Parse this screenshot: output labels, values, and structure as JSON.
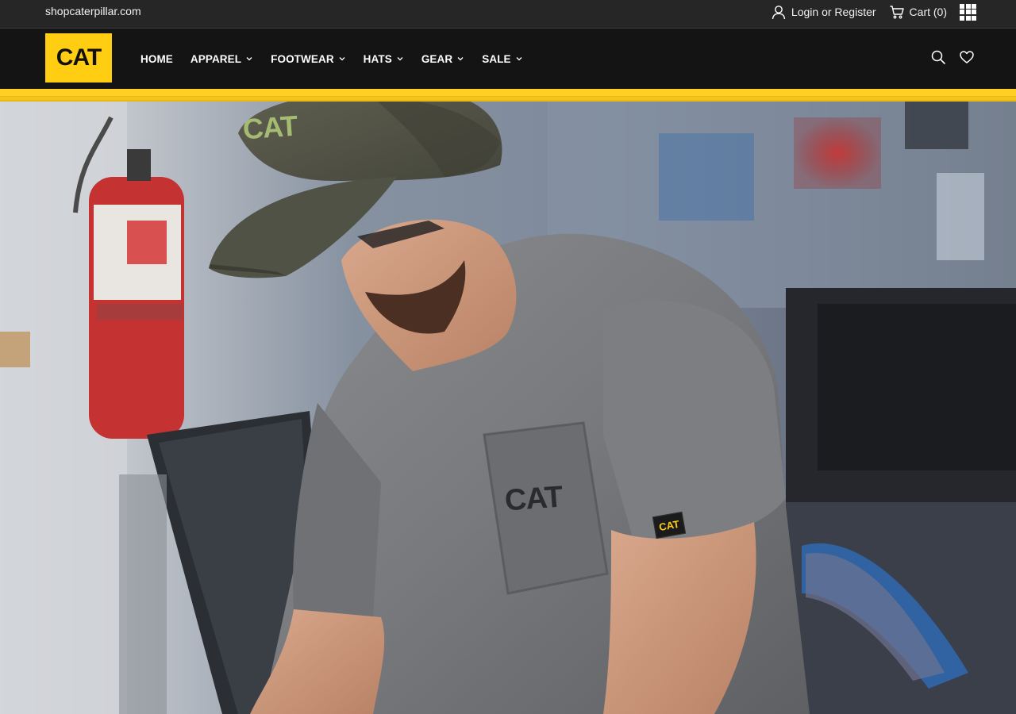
{
  "utility": {
    "domain": "shopcaterpillar.com",
    "login_label": "Login or Register",
    "cart_label": "Cart (0)",
    "icons": [
      "user-icon",
      "cart-icon",
      "apps-grid-icon"
    ]
  },
  "nav": {
    "logo_text": "CAT",
    "items": [
      {
        "label": "HOME",
        "has_dropdown": false
      },
      {
        "label": "APPAREL",
        "has_dropdown": true
      },
      {
        "label": "FOOTWEAR",
        "has_dropdown": true
      },
      {
        "label": "HATS",
        "has_dropdown": true
      },
      {
        "label": "GEAR",
        "has_dropdown": true
      },
      {
        "label": "SALE",
        "has_dropdown": true
      }
    ],
    "icons": [
      "search-icon",
      "heart-icon"
    ]
  },
  "hero": {
    "cap_logo": "CAT",
    "shirt_logo": "CAT",
    "sleeve_tag": "CAT"
  },
  "colors": {
    "brand_yellow": "#ffcd11",
    "nav_bg": "#141414",
    "utility_bg": "#262626"
  }
}
